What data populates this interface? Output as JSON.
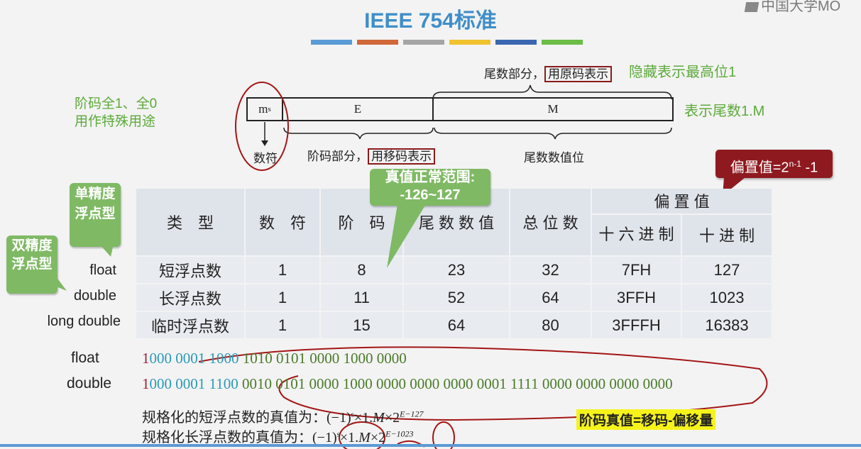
{
  "slide": {
    "title": "IEEE 754标准",
    "logo_text": "中国大学MO",
    "stripe_colors": [
      "#5b9bd5",
      "#d0683a",
      "#a5a5a5",
      "#f0c22e",
      "#3a67b0",
      "#6bbd45"
    ]
  },
  "diagram": {
    "mantissa_part_prefix": "尾数部分，",
    "mantissa_part_boxed": "用原码表示",
    "hidden_bit_note": "隐藏表示最高位1",
    "exponent_special_line1": "阶码全1、全0",
    "exponent_special_line2": "用作特殊用途",
    "field_ms_main": "m",
    "field_ms_sub": "s",
    "field_e": "E",
    "field_m": "M",
    "mantissa_meaning": "表示尾数1.M",
    "sign_label": "数符",
    "exponent_part_prefix": "阶码部分，",
    "exponent_part_boxed": "用移码表示",
    "mantissa_bits_label": "尾数数值位"
  },
  "callouts": {
    "bias_prefix": "偏置值=2",
    "bias_sup": "n-1",
    "bias_suffix": " -1",
    "range_line1": "真值正常范围:",
    "range_line2": "-126~127",
    "single_label": "单精度浮点型",
    "double_label": "双精度浮点型"
  },
  "table": {
    "headers": {
      "type": "类　型",
      "sign": "数　符",
      "exponent": "阶　码",
      "mantissa": "尾 数 数 值",
      "total": "总 位 数",
      "bias": "偏 置 值",
      "hex": "十 六 进 制",
      "dec": "十 进 制"
    },
    "rows": [
      {
        "label": "float",
        "type": "短浮点数",
        "sign": "1",
        "exponent": "8",
        "mantissa": "23",
        "total": "32",
        "hex": "7FH",
        "dec": "127"
      },
      {
        "label": "double",
        "type": "长浮点数",
        "sign": "1",
        "exponent": "11",
        "mantissa": "52",
        "total": "64",
        "hex": "3FFH",
        "dec": "1023"
      },
      {
        "label": "long double",
        "type": "临时浮点数",
        "sign": "1",
        "exponent": "15",
        "mantissa": "64",
        "total": "80",
        "hex": "3FFFH",
        "dec": "16383"
      }
    ]
  },
  "examples": {
    "float_label": "float",
    "float_sign": "1",
    "float_exp": "000 0001 1000",
    "float_mant": " 1010 0101 0000 1000 0000",
    "double_label": "double",
    "double_sign": "1",
    "double_exp": "000 0001 1100",
    "double_mant": " 0010 0101 0000 1000 0000 0000 0000 0001 1111 0000 0000 0000 0000"
  },
  "formulas": {
    "single_text": "规格化的短浮点数的真值为：",
    "single_formula": "(−1)",
    "single_s": "s",
    "single_mid": "×1.",
    "single_M": "M",
    "single_times2": "×2",
    "single_exp": "E−127",
    "double_text": "规格化长浮点数的真值为：",
    "double_formula": "(−1)",
    "double_s": "s",
    "double_mid": "×1.",
    "double_M": "M",
    "double_times2": "×2",
    "double_exp": "E−1023",
    "exp_note": "阶码真值=移码-偏移量"
  }
}
